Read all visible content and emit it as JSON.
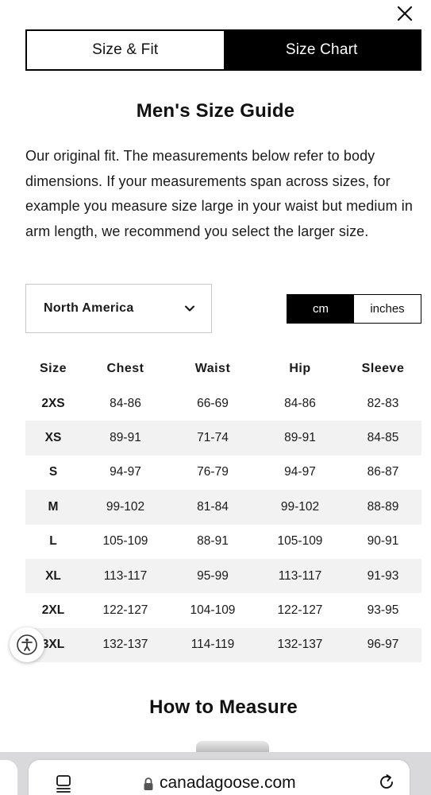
{
  "tabs": [
    {
      "label": "Size & Fit",
      "active": false
    },
    {
      "label": "Size Chart",
      "active": true
    }
  ],
  "title": "Men's Size Guide",
  "description": "Our original fit. The measurements below refer to body dimensions. If your measurements span across sizes, for example you measure size large in your waist but medium in arm length, we recommend you select the larger size.",
  "region": {
    "selected": "North America",
    "icon": "chevron-down-icon"
  },
  "units": {
    "cm": "cm",
    "inches": "inches",
    "active": "cm"
  },
  "table": {
    "headers": [
      "Size",
      "Chest",
      "Waist",
      "Hip",
      "Sleeve"
    ],
    "rows": [
      [
        "2XS",
        "84-86",
        "66-69",
        "84-86",
        "82-83"
      ],
      [
        "XS",
        "89-91",
        "71-74",
        "89-91",
        "84-85"
      ],
      [
        "S",
        "94-97",
        "76-79",
        "94-97",
        "86-87"
      ],
      [
        "M",
        "99-102",
        "81-84",
        "99-102",
        "88-89"
      ],
      [
        "L",
        "105-109",
        "88-91",
        "105-109",
        "90-91"
      ],
      [
        "XL",
        "113-117",
        "95-99",
        "113-117",
        "91-93"
      ],
      [
        "2XL",
        "122-127",
        "104-109",
        "122-127",
        "93-95"
      ],
      [
        "3XL",
        "132-137",
        "114-119",
        "132-137",
        "96-97"
      ]
    ]
  },
  "how_to_measure": "How to Measure",
  "browser": {
    "url": "canadagoose.com"
  },
  "colors": {
    "accent": "#000000",
    "row_shade": "#f2f2f2",
    "browser_bar": "#d9d9db"
  }
}
